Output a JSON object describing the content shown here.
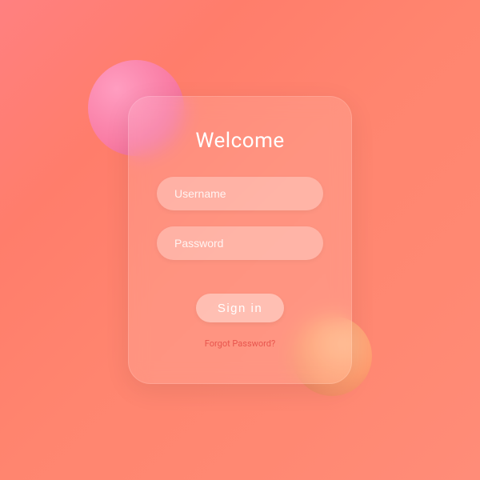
{
  "login": {
    "title": "Welcome",
    "username_placeholder": "Username",
    "password_placeholder": "Password",
    "signin_label": "Sign in",
    "forgot_label": "Forgot Password?"
  }
}
